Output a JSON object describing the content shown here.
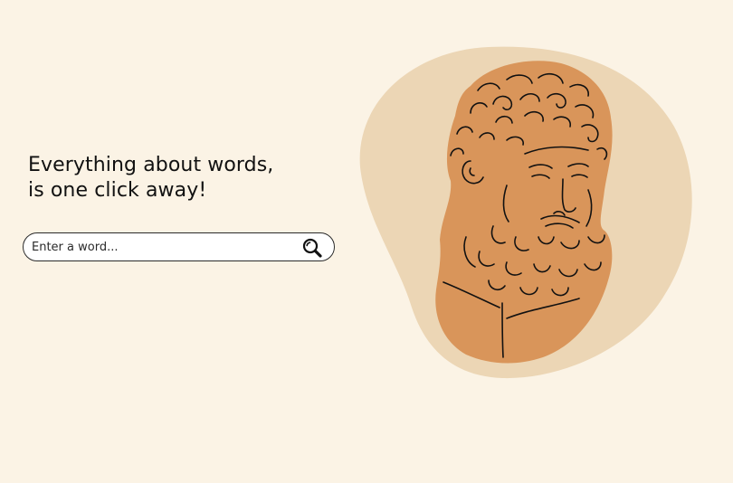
{
  "hero": {
    "headline_line1": "Everything about words,",
    "headline_line2": "is one click away!"
  },
  "search": {
    "placeholder": "Enter a word...",
    "value": "",
    "button_icon": "search-icon"
  },
  "illustration": {
    "subject": "bearded-bust-icon"
  },
  "colors": {
    "background": "#fbf3e5",
    "blob": "#ecd6b5",
    "bust": "#d9955a",
    "line": "#111111"
  }
}
